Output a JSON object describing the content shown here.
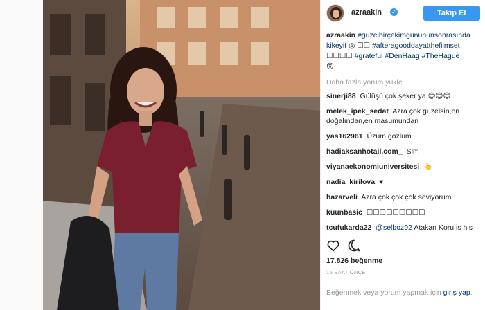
{
  "header": {
    "username": "azraakin",
    "verified_icon": "check-icon",
    "follow_label": "Takip Et"
  },
  "caption": {
    "username": "azraakin",
    "text_1": "#güzelbirçekimgünününsonrasında",
    "text_2": "kikeyif",
    "text_3": "◎ ☐☐",
    "text_4": "#afteragooddayatthefilmset",
    "text_5": "☐☐☐☐",
    "tag_grateful": "#grateful",
    "tag_denhaag": "#DenHaag",
    "tag_thehague": "#TheHague",
    "text_6": "😮"
  },
  "load_more": "Daha fazla yorum yükle",
  "comments": [
    {
      "user": "sinerji88",
      "text": "Gülüşü çok şeker ya 😊😊😊"
    },
    {
      "user": "melek_ipek_sedat",
      "text": "Azra çok güzelsin,en doğalından,en masumundan"
    },
    {
      "user": "yas162961",
      "text": "Üzüm gözlüm"
    },
    {
      "user": "hadiaksanhotail.com_",
      "text": "Slm"
    },
    {
      "user": "viyanaekonomiuniversitesi",
      "text": "👆"
    },
    {
      "user": "nadia_kirilova",
      "text": "♥"
    },
    {
      "user": "hazarveli",
      "text": "Azra çok çok çok seviyorum"
    },
    {
      "user": "kuunbasic",
      "text": "☐☐☐☐☐☐☐☐☐"
    },
    {
      "user": "tcufukarda22",
      "mention": "@selboz92",
      "text": "Atakan Koru is his wife is the reason of happiness is my"
    }
  ],
  "actions": {
    "like_icon": "heart-icon",
    "comment_icon": "comment-bubble-icon",
    "likes": "17.826 beğenme",
    "time": "15 SAAT ÖNCE"
  },
  "add_comment": {
    "prefix": "Beğenmek veya yorum yapmak için",
    "link": "giriş yap",
    "suffix": "."
  },
  "colors": {
    "accent": "#3897f0",
    "hashtag": "#003569",
    "muted": "#999999",
    "shirt": "#7a1f2e"
  }
}
